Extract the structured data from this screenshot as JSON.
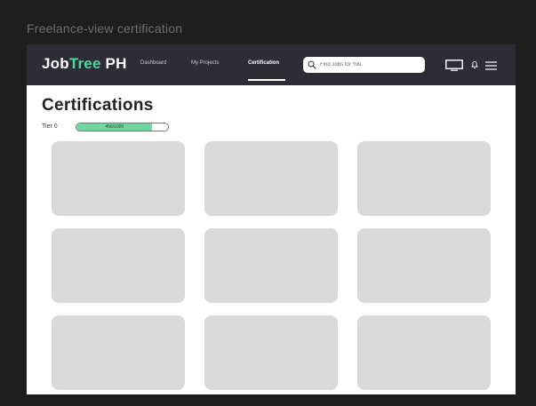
{
  "frame_label": "Freelance-view certification",
  "app": {
    "logo": {
      "part1": "Job",
      "part2": "Tree",
      "part3": " PH",
      "accent_color": "#4fd9a0"
    },
    "nav": [
      {
        "label": "Dashboard",
        "active": false
      },
      {
        "label": "My Projects",
        "active": false
      },
      {
        "label": "Certification",
        "active": true
      }
    ],
    "search": {
      "placeholder": "Find Jobs for You.",
      "value": ""
    },
    "icons": [
      "monitor-icon",
      "bell-icon",
      "menu-icon"
    ]
  },
  "page": {
    "title": "Certifications",
    "tier": {
      "label": "Tier 0",
      "progress_text": "456/1000",
      "progress_fraction": 0.83
    },
    "cards": [
      {},
      {},
      {},
      {},
      {},
      {},
      {},
      {},
      {}
    ]
  },
  "colors": {
    "navbar": "#2e2d36",
    "card": "#d9d9d9",
    "progress": "#6dd9a0"
  }
}
